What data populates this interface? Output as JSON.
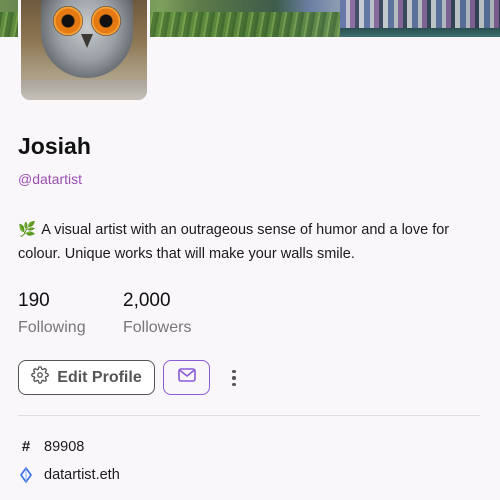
{
  "profile": {
    "name": "Josiah",
    "handle": "@datartist",
    "bio_icon": "seedling-emoji",
    "bio_emoji": "🌿",
    "bio": "A visual artist with an outrageous sense of humor and a love for colour. Unique works that will make your walls smile."
  },
  "stats": {
    "following_count": "190",
    "following_label": "Following",
    "followers_count": "2,000",
    "followers_label": "Followers"
  },
  "actions": {
    "edit_profile_label": "Edit Profile",
    "edit_icon": "gear-icon",
    "message_icon": "mail-icon",
    "more_icon": "more-vertical-icon"
  },
  "meta": {
    "token_symbol": "#",
    "token_id": "89908",
    "ens_icon": "ethereum-icon",
    "ens_name": "datartist.eth"
  },
  "colors": {
    "accent": "#8a5cd8",
    "handle": "#9a4fb0",
    "background": "#faf7fb"
  }
}
